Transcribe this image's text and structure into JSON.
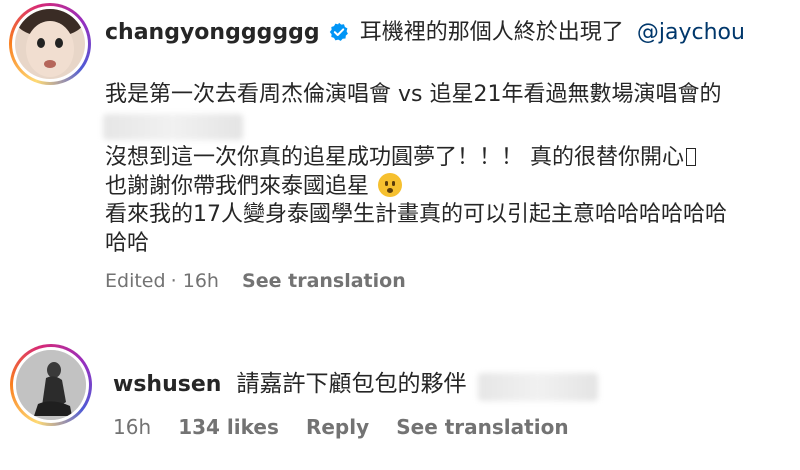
{
  "comment1": {
    "username": "changyongggggg",
    "header_text": "耳機裡的那個人終於出現了",
    "mention": "@jaychou",
    "lines": [
      "我是第一次去看周杰倫演唱會 vs 追星21年看過無數場演唱會的",
      "",
      "沒想到這一次你真的追星成功圓夢了！！！ 真的很替你開心",
      "也謝謝你帶我們來泰國追星",
      "看來我的17人變身泰國學生計畫真的可以引起主意哈哈哈哈哈哈",
      "哈哈"
    ],
    "edited": "Edited",
    "time": "16h",
    "see_translation": "See translation"
  },
  "comment2": {
    "username": "wshusen",
    "text": "請嘉許下顧包包的夥伴",
    "time": "16h",
    "likes": "134 likes",
    "reply": "Reply",
    "see_translation": "See translation"
  },
  "icons": {
    "verified": "verified-badge-icon",
    "emoji": "face-with-open-mouth-emoji"
  },
  "colors": {
    "text": "#262626",
    "meta": "#737373",
    "mention": "#00376b",
    "verified": "#0095f6"
  }
}
